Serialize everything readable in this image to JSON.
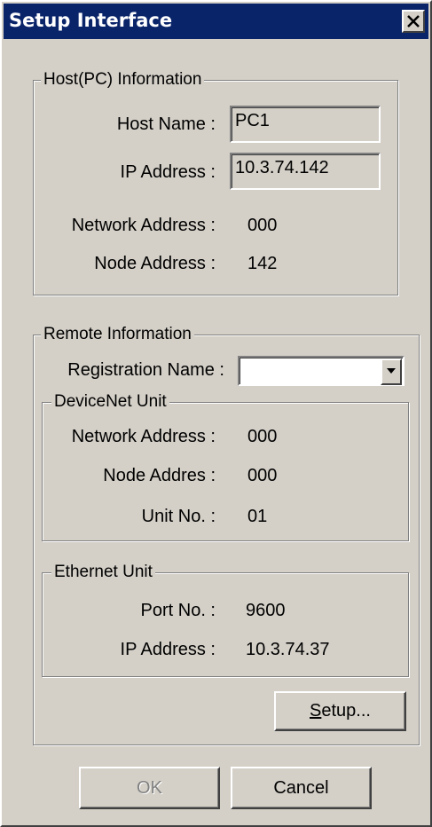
{
  "window": {
    "title": "Setup Interface"
  },
  "icons": {
    "close": "close-icon",
    "dropdown": "chevron-down-icon"
  },
  "colors": {
    "titlebar": "#0a246a",
    "face": "#d4d0c8"
  },
  "host": {
    "group_label": "Host(PC) Information",
    "host_name_label": "Host Name :",
    "host_name_value": "PC1",
    "ip_address_label": "IP Address :",
    "ip_address_value": "10.3.74.142",
    "network_address_label": "Network Address :",
    "network_address_value": "000",
    "node_address_label": "Node Address :",
    "node_address_value": "142"
  },
  "remote": {
    "group_label": "Remote Information",
    "registration_name_label": "Registration Name :",
    "registration_name_value": "",
    "devicenet": {
      "group_label": "DeviceNet Unit",
      "network_address_label": "Network Address :",
      "network_address_value": "000",
      "node_address_label": "Node Addres :",
      "node_address_value": "000",
      "unit_no_label": "Unit No. :",
      "unit_no_value": "01"
    },
    "ethernet": {
      "group_label": "Ethernet Unit",
      "port_no_label": "Port No. :",
      "port_no_value": "9600",
      "ip_address_label": "IP Address :",
      "ip_address_value": "10.3.74.37"
    },
    "setup_button": {
      "mnemonic": "S",
      "rest": "etup..."
    }
  },
  "buttons": {
    "ok": "OK",
    "cancel": "Cancel"
  }
}
